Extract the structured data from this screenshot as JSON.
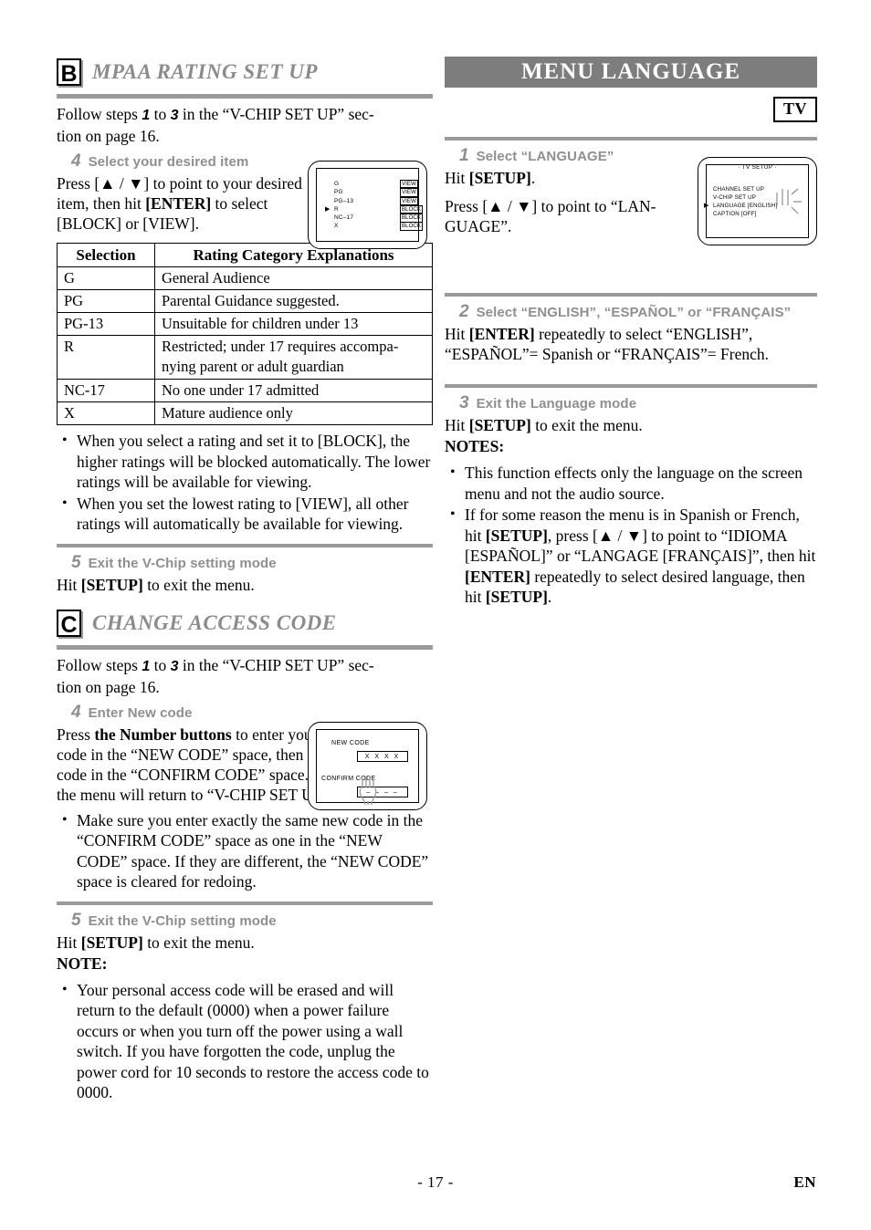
{
  "page": {
    "number": "- 17 -",
    "lang_code": "EN"
  },
  "left": {
    "section_b": {
      "badge": "B",
      "title": "MPAA RATING SET UP",
      "intro_1": "Follow steps ",
      "intro_num_a": "1",
      "intro_2": " to ",
      "intro_num_b": "3",
      "intro_3": " in the “V-CHIP SET UP” sec-",
      "intro_4": "tion on page 16.",
      "step4": {
        "num": "4",
        "label": "Select your desired item",
        "body_a": "Press [▲ / ▼] to point to your desired item, then hit ",
        "body_bold": "[ENTER]",
        "body_b": " to select [BLOCK] or [VIEW]."
      },
      "vchip_screen": {
        "rows": [
          {
            "caret": "",
            "name": "G",
            "value": "VIEW"
          },
          {
            "caret": "",
            "name": "PG",
            "value": "VIEW"
          },
          {
            "caret": "",
            "name": "PG–13",
            "value": "VIEW"
          },
          {
            "caret": "▶",
            "name": "R",
            "value": "BLOCK"
          },
          {
            "caret": "",
            "name": "NC–17",
            "value": "BLOCK"
          },
          {
            "caret": "",
            "name": "X",
            "value": "BLOCK"
          }
        ]
      },
      "table": {
        "headers": [
          "Selection",
          "Rating Category Explanations"
        ],
        "rows": [
          [
            "G",
            "General Audience"
          ],
          [
            "PG",
            "Parental Guidance suggested."
          ],
          [
            "PG-13",
            "Unsuitable for children under 13"
          ],
          [
            "R",
            "Restricted; under 17 requires accompa-nying parent or adult guardian"
          ],
          [
            "NC-17",
            "No one under 17 admitted"
          ],
          [
            "X",
            "Mature audience only"
          ]
        ]
      },
      "bullets": [
        "When you select a rating and set it to [BLOCK], the higher ratings will be blocked automatically. The lower ratings will be available for viewing.",
        "When you set the lowest rating to [VIEW], all other ratings will automatically be available for viewing."
      ],
      "step5": {
        "num": "5",
        "label": "Exit the V-Chip setting mode",
        "body_a": "Hit ",
        "body_bold": "[SETUP]",
        "body_b": " to exit the menu."
      }
    },
    "section_c": {
      "badge": "C",
      "title": "CHANGE ACCESS CODE",
      "intro_1": "Follow steps ",
      "intro_num_a": "1",
      "intro_2": " to ",
      "intro_num_b": "3",
      "intro_3": " in the “V-CHIP SET UP” sec-",
      "intro_4": "tion on page 16.",
      "step4": {
        "num": "4",
        "label": "Enter New code",
        "body_a": "Press ",
        "body_bold": "the Number buttons",
        "body_b": " to enter your desired access code in the “NEW CODE” space, then enter the same code in the “CONFIRM CODE” space. When completed, the menu will return to “V-CHIP SET UP”."
      },
      "code_screen": {
        "new_code_label": "NEW CODE",
        "new_code_value": "X X X X",
        "confirm_code_label": "CONFIRM CODE",
        "confirm_code_value": "– – – –"
      },
      "bullets": [
        "Make sure you enter exactly the same new code in the “CONFIRM CODE” space as one in the “NEW CODE” space. If they are different, the “NEW CODE” space is cleared for redoing."
      ],
      "step5": {
        "num": "5",
        "label": "Exit the V-Chip setting mode",
        "body_a": "Hit ",
        "body_bold": "[SETUP]",
        "body_b": " to exit the menu."
      },
      "note_head": "NOTE:",
      "note_bullets": [
        "Your personal access code will be erased and will return to the default (0000) when a power failure occurs or when you turn off the power using a wall switch. If you have forgotten the code, unplug the power cord for 10 seconds to restore the access code to 0000."
      ]
    }
  },
  "right": {
    "banner_title": "MENU LANGUAGE",
    "tv_tag": "TV",
    "step1": {
      "num": "1",
      "label": "Select “LANGUAGE”",
      "body_a": "Hit ",
      "body_bold": "[SETUP]",
      "body_b": ".",
      "body_c": "Press [▲ / ▼] to point to “LAN-GUAGE”."
    },
    "tvsetup_screen": {
      "title": "· TV SETUP ·",
      "rows": [
        {
          "caret": "",
          "text": "CHANNEL SET UP"
        },
        {
          "caret": "",
          "text": "V-CHIP SET UP"
        },
        {
          "caret": "▶",
          "text": "LANGUAGE  [ENGLISH]"
        },
        {
          "caret": "",
          "text": "CAPTION  [OFF]"
        }
      ]
    },
    "step2": {
      "num": "2",
      "label": "Select “ENGLISH”, “ESPAÑOL” or “FRANÇAIS”",
      "body_a": "Hit ",
      "body_bold": "[ENTER]",
      "body_b": " repeatedly to select “ENGLISH”, “ESPAÑOL”= Spanish or “FRANÇAIS”= French."
    },
    "step3": {
      "num": "3",
      "label": "Exit the Language mode",
      "body_a": "Hit ",
      "body_bold": "[SETUP]",
      "body_b": " to exit the menu."
    },
    "notes_head": "NOTES:",
    "notes": [
      {
        "parts": [
          {
            "t": "This function effects only the language on the screen menu and not the audio source.",
            "b": false
          }
        ]
      },
      {
        "parts": [
          {
            "t": "If for some reason the menu is in Spanish or French, hit ",
            "b": false
          },
          {
            "t": "[SETUP]",
            "b": true
          },
          {
            "t": ", press [▲ / ▼] to point to “IDIOMA [ESPAÑOL]” or “LANGAGE [FRANÇAIS]”, then hit ",
            "b": false
          },
          {
            "t": "[ENTER]",
            "b": true
          },
          {
            "t": " repeatedly to select desired language, then hit ",
            "b": false
          },
          {
            "t": "[SETUP]",
            "b": true
          },
          {
            "t": ".",
            "b": false
          }
        ]
      }
    ]
  },
  "colors": {
    "banner_gray": "#7d7d7d",
    "rule_gray": "#9a9a9a",
    "step_gray": "#8f8f8f",
    "title_gray": "#8c8c8c"
  }
}
